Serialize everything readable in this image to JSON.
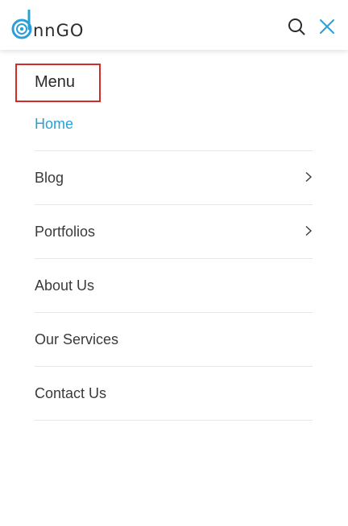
{
  "header": {
    "logo_text": "nnGO",
    "logo_color": "#2a9fd8",
    "search_icon": "search-icon",
    "close_icon": "close-icon",
    "close_color": "#2a9fd8"
  },
  "menu": {
    "heading": "Menu",
    "items": [
      {
        "label": "Home",
        "active": true,
        "has_submenu": false
      },
      {
        "label": "Blog",
        "active": false,
        "has_submenu": true
      },
      {
        "label": "Portfolios",
        "active": false,
        "has_submenu": true
      },
      {
        "label": "About Us",
        "active": false,
        "has_submenu": false
      },
      {
        "label": "Our Services",
        "active": false,
        "has_submenu": false
      },
      {
        "label": "Contact Us",
        "active": false,
        "has_submenu": false
      }
    ]
  },
  "colors": {
    "accent": "#2a9fd8",
    "highlight_border": "#d32a2a",
    "text": "#3a3a3a"
  }
}
